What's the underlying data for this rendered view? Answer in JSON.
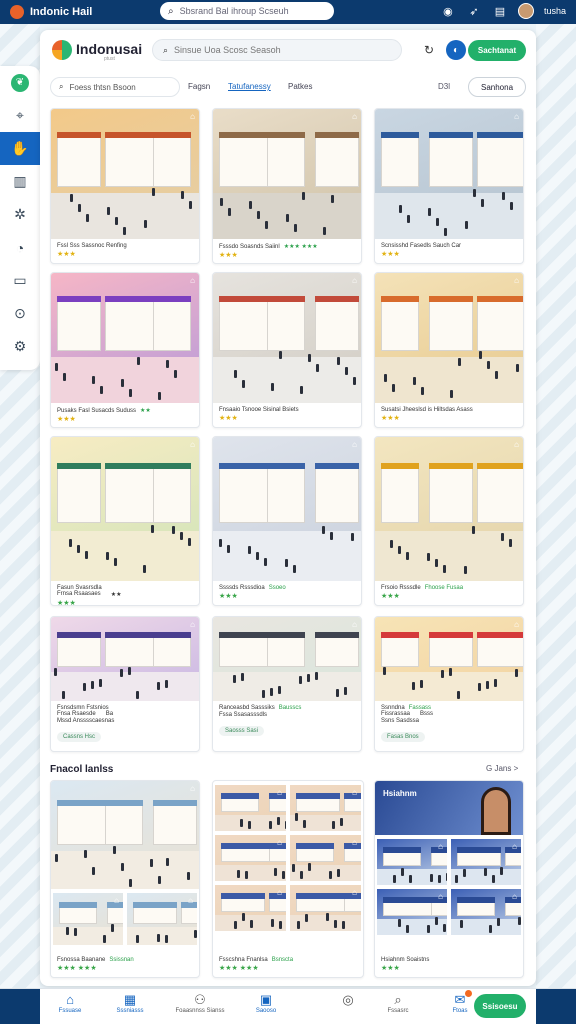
{
  "app": {
    "title": "Indonic Hail"
  },
  "topbar": {
    "search_placeholder": "Sbsrand Bal ihroup Scseuh",
    "user_name": "tusha"
  },
  "header": {
    "brand": "Indonusai",
    "brand_sub": "ptust",
    "search_placeholder": "Sinsue Uoa Scosc Seasoh",
    "cta_label": "Sachtanat"
  },
  "filters": {
    "search_placeholder": "Foess thtsn Bsoon",
    "tabs": [
      "Fagsn",
      "Tatufanessy",
      "Patkes"
    ],
    "active_tab": 1,
    "count": "D3l",
    "button_label": "Sanhona"
  },
  "colors": {
    "accent": "#1565c0",
    "cta": "#22b06a",
    "nav": "#0c3a6e",
    "star": "#e2b314"
  },
  "cards": [
    {
      "caption": "Fssl Sss Sassnoc Renfing",
      "tag": "",
      "stars": "★★★",
      "star_color": "gold",
      "theme": [
        "#f3c989",
        "#e3cfa8",
        "#c6542b",
        "#e9e5df"
      ]
    },
    {
      "caption": "Fsssdo Soasnds Saiinl",
      "tag": "★★★ ★★★",
      "stars": "★★★",
      "star_color": "gold",
      "theme": [
        "#e9ddc8",
        "#cfc2a8",
        "#8e6a48",
        "#d9d4ca"
      ]
    },
    {
      "caption": "Scnsisshd Fasedls Sauch Car",
      "tag": "",
      "stars": "★★★",
      "star_color": "gold",
      "theme": [
        "#c9d6e2",
        "#b5c3cf",
        "#2e5b9c",
        "#dfe6ec"
      ]
    },
    {
      "caption": "Pusaks Fasl Susacds Suduss",
      "tag": "★★",
      "stars": "★★★",
      "star_color": "gold",
      "theme": [
        "#f6b6c6",
        "#b79ad9",
        "#7b3fc0",
        "#f1d3dc"
      ]
    },
    {
      "caption": "Fnsaaio Tsnooe Sisinal Bsiets",
      "tag": "",
      "stars": "★★★",
      "star_color": "gold",
      "theme": [
        "#e6e3de",
        "#d1ccc3",
        "#c24a3a",
        "#ecebe8"
      ]
    },
    {
      "caption": "Susatsi Jheeslsd is Hiltsdas Asass",
      "tag": "",
      "stars": "★★★",
      "star_color": "gold",
      "theme": [
        "#f4e2b8",
        "#e7c98d",
        "#d86b2c",
        "#efe5cf"
      ]
    },
    {
      "caption": "Fasun Svasrsdla",
      "tag": "",
      "stars": "★★★",
      "star_color": "green",
      "tags": [
        "Frnsa Rsaasaes",
        "★★"
      ],
      "theme": [
        "#f7ecc3",
        "#cfe3b8",
        "#2f7d5d",
        "#f2ecd2"
      ]
    },
    {
      "caption": "Ssssds Rsssdioa",
      "tag": "Ssoeo",
      "stars": "★★★",
      "star_color": "green",
      "theme": [
        "#dfe4ec",
        "#c9d0dc",
        "#3a63a8",
        "#eaedf2"
      ]
    },
    {
      "caption": "Frsoio Rsssdle",
      "tag": "Fhoose Fusaa",
      "stars": "★★★",
      "star_color": "green",
      "theme": [
        "#f3e6c0",
        "#e2d2a8",
        "#e0a21e",
        "#efe7d1"
      ]
    },
    {
      "caption": "Fsnsdsmn Fstsnios",
      "tag": "",
      "stars": "Mssd Ansssscaesnas",
      "star_color": "text",
      "tags": [
        "Fnsa Rsaesde",
        "Ba"
      ],
      "chip": "Cassns Hsc",
      "chip_color": "green",
      "theme": [
        "#efd9e8",
        "#c9b7e3",
        "#4a3e8f",
        "#efe8ee"
      ]
    },
    {
      "caption": "Ranceasbd Sasssiks",
      "tag": "Bausscs",
      "stars": "Fssa Ssasasssdls",
      "star_color": "text",
      "chip": "Saosss Sasi",
      "chip_color": "green",
      "theme": [
        "#e9e6e0",
        "#d9e6dc",
        "#3f4450",
        "#efece6"
      ]
    },
    {
      "caption": "Ssnndna",
      "tag": "Fassass",
      "stars": "Ssns Sasdssa",
      "star_color": "text",
      "tags": [
        "Fissrassaa",
        "Bsss"
      ],
      "chip": "Fasas Bnos",
      "chip_color": "green",
      "theme": [
        "#f7e4b6",
        "#f2d3a2",
        "#d53a3a",
        "#f4ead3"
      ]
    }
  ],
  "section": {
    "title": "Fnacol lanlss",
    "link": "G Jans >"
  },
  "grid_cards": [
    {
      "caption": "Fsnossa Baanane",
      "tag": "Ssissnan",
      "stars": "★★★",
      "stars2": "★★★",
      "theme": [
        "#dbe8f2",
        "#e9e1d2",
        "#7aa3c7",
        "#f2ece2"
      ]
    },
    {
      "caption": "Fsscshna Fnanlsa",
      "tag": "Bsnscta",
      "stars": "★★★",
      "stars2": "★★★",
      "theme": [
        "#f0d9c3",
        "#ecd3b6",
        "#3c5aa6",
        "#efe3d6"
      ]
    },
    {
      "caption": "Hsiahnm Soaistns",
      "tag": "",
      "stars": "★★★",
      "stars2": "",
      "hero": "Hsiahnm",
      "theme": [
        "#3b5fb5",
        "#c7d6ea",
        "#2a4a94",
        "#dde6f0"
      ]
    }
  ],
  "bottom_nav": [
    {
      "label": "Fssuase",
      "icon": "⌂"
    },
    {
      "label": "Sssniasss",
      "icon": "▦"
    },
    {
      "label": "Foaasnnss Sianss",
      "icon": "⚇"
    },
    {
      "label": "Saooso",
      "icon": "▣"
    },
    {
      "label": "",
      "icon": "◎"
    },
    {
      "label": "Fssasrc",
      "icon": "⌕"
    },
    {
      "label": "Ftoas",
      "icon": "✉"
    }
  ],
  "bottom_cta": "Ssisoesu"
}
